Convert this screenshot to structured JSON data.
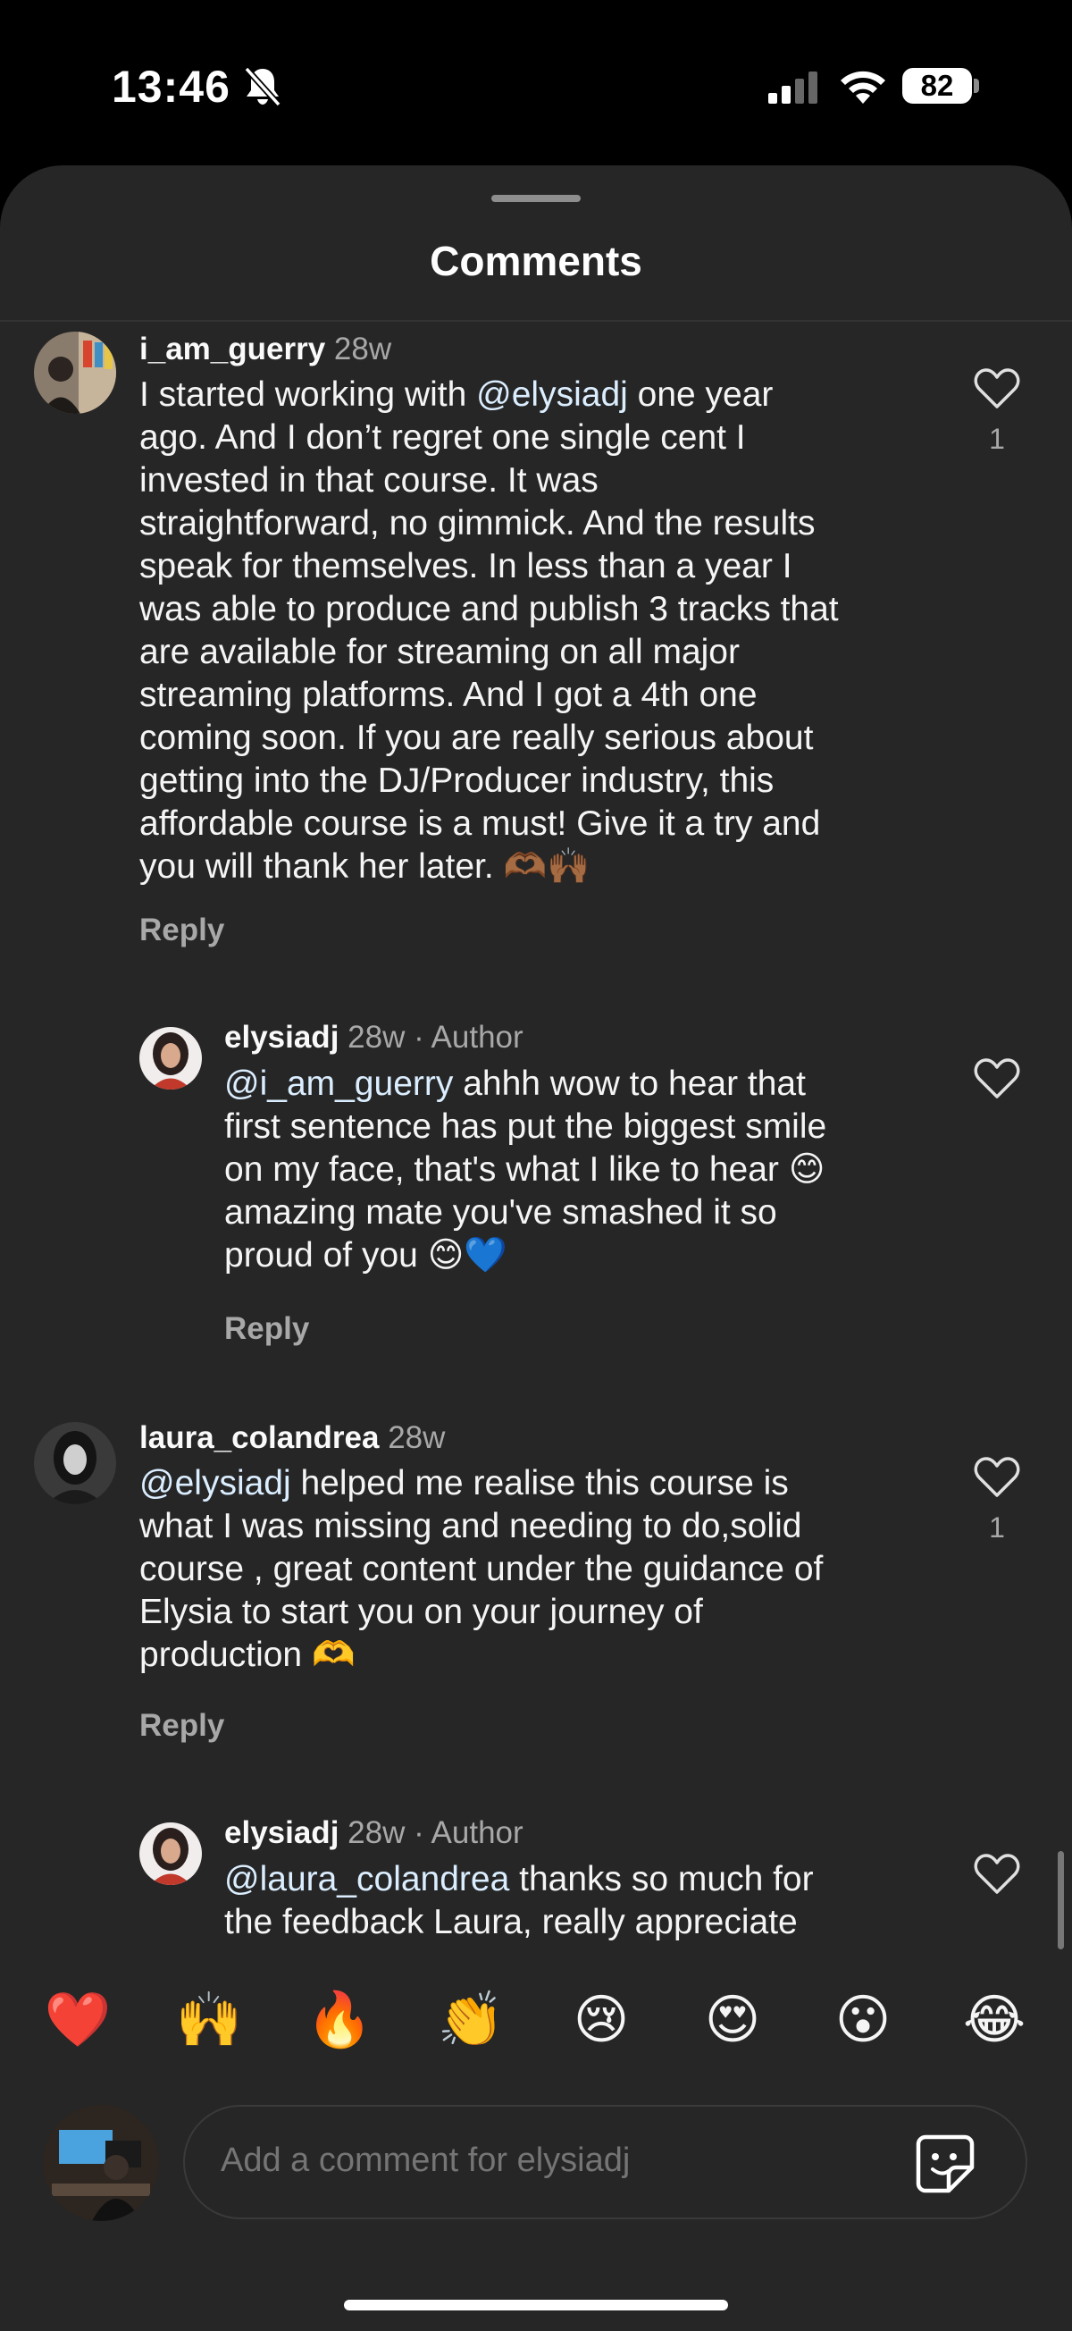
{
  "status_bar": {
    "time": "13:46",
    "battery": "82"
  },
  "sheet": {
    "title": "Comments"
  },
  "comments": [
    {
      "username": "i_am_guerry",
      "age": "28w",
      "lines": [
        "I started working with @elysiadj one year",
        "ago. And I don’t regret one single cent I",
        "invested in that course. It was",
        "straightforward, no gimmick. And the results",
        "speak for themselves. In less than a year I",
        "was able to produce and publish 3 tracks that",
        "are available for streaming on all major",
        "streaming platforms. And I got a 4th one",
        "coming soon. If you are really serious about",
        "getting into the DJ/Producer industry, this",
        "affordable course is a must! Give it a try and",
        "you will thank her later. 🫶🏾🙌🏾"
      ],
      "mention": "@elysiadj",
      "reply_label": "Reply",
      "likes": "1"
    },
    {
      "username": "elysiadj",
      "age": "28w",
      "author_tag": "· Author",
      "mention": "@i_am_guerry",
      "lines": [
        "@i_am_guerry ahhh wow to hear that",
        "first sentence has put the biggest smile",
        "on my face, that's what I like to hear 😊",
        "amazing mate you've smashed it so",
        "proud of you 😊💙"
      ],
      "reply_label": "Reply"
    },
    {
      "username": "laura_colandrea",
      "age": "28w",
      "mention": "@elysiadj",
      "lines": [
        "@elysiadj  helped  me realise this course is",
        "what I was missing and  needing to do,solid",
        "course , great content under the guidance of",
        "Elysia to start you on your journey of",
        "production 🫶"
      ],
      "reply_label": "Reply",
      "likes": "1"
    },
    {
      "username": "elysiadj",
      "age": "28w",
      "author_tag": "· Author",
      "mention": "@laura_colandrea",
      "lines": [
        "@laura_colandrea thanks so much for",
        "the feedback Laura, really appreciate"
      ]
    }
  ],
  "emoji_bar": [
    "❤️",
    "🙌",
    "🔥",
    "👏",
    "😢",
    "😍",
    "😮",
    "😂"
  ],
  "composer": {
    "placeholder": "Add a comment for elysiadj"
  },
  "icons": {
    "heart": "heart-outline-icon",
    "sticker": "sticker-icon",
    "bell_muted": "bell-slash-icon",
    "wifi": "wifi-icon",
    "signal": "cellular-signal-icon"
  }
}
